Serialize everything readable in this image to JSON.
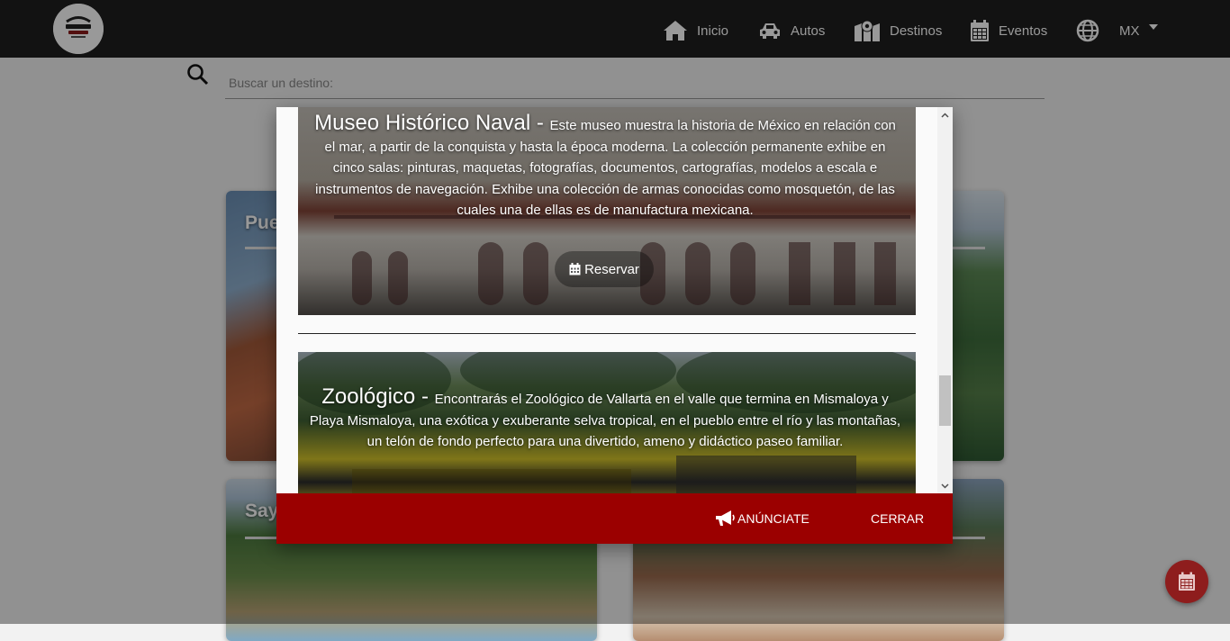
{
  "navbar": {
    "logo_alt": "Move Time",
    "items": [
      {
        "label": "Inicio",
        "icon": "home-icon"
      },
      {
        "label": "Autos",
        "icon": "car-icon"
      },
      {
        "label": "Destinos",
        "icon": "map-marker-icon"
      },
      {
        "label": "Eventos",
        "icon": "calendar-icon"
      },
      {
        "label": "MX",
        "icon": "globe-icon"
      }
    ]
  },
  "search": {
    "placeholder": "Buscar un destino:"
  },
  "cards": [
    {
      "title": "Pue"
    },
    {
      "title": ""
    },
    {
      "title": "Say"
    },
    {
      "title": ""
    }
  ],
  "modal": {
    "attractions": [
      {
        "name": "Museo Histórico Naval",
        "separator": " - ",
        "description": "Este museo muestra la historia de México en relación con el mar, a partir de la conquista y hasta la época moderna. La colección permanente exhibe en cinco salas: pinturas, maquetas, fotografías, documentos, cartografías, modelos a escala e instrumentos de navegación. Exhibe una colección de armas conocidas como mosquetón, de las cuales una de ellas es de manufactura mexicana.",
        "button_label": "Reservar"
      },
      {
        "name": "Zoológico",
        "separator": " - ",
        "description": "Encontrarás el Zoológico de Vallarta en el valle que termina en Mismaloya y Playa Mismaloya, una exótica y exuberante selva tropical, en el pueblo entre el río y las montañas, un telón de fondo perfecto para una divertido, ameno y didáctico paseo familiar."
      }
    ],
    "footer": {
      "anunciate_label": "ANÚNCIATE",
      "cerrar_label": "CERRAR"
    }
  },
  "colors": {
    "navbar_bg": "#1f1f1f",
    "footer_bg": "#9b0000",
    "fab_bg": "#8e1d1d"
  }
}
